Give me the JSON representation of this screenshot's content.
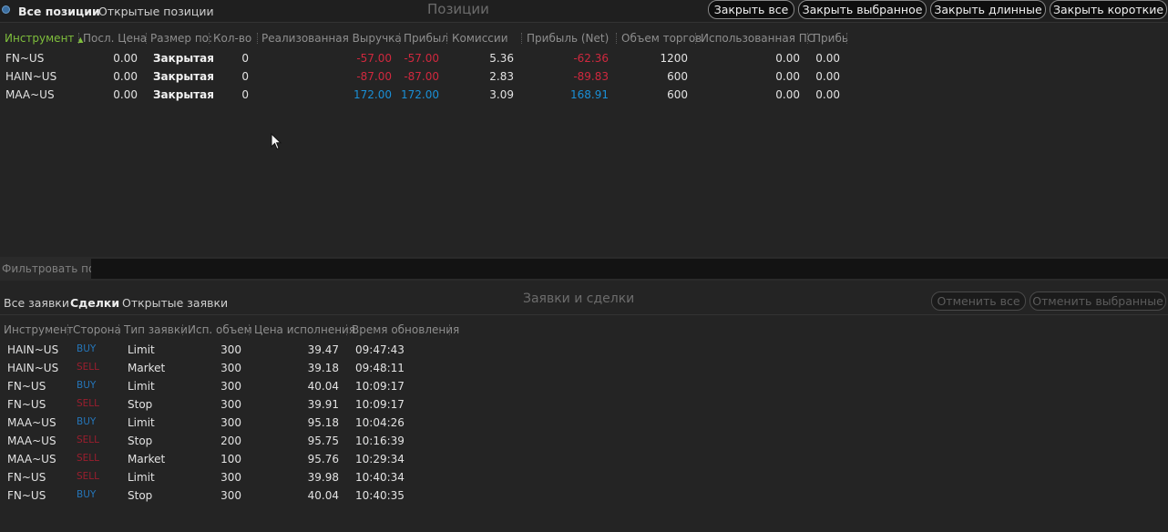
{
  "positions": {
    "tabs": [
      "Все позиции",
      "Открытые позиции"
    ],
    "title": "Позиции",
    "buttons": [
      "Закрыть все",
      "Закрыть выбранное",
      "Закрыть длинные",
      "Закрыть короткие"
    ],
    "columns": [
      "Инструмент",
      "Посл. Цена",
      "Размер по:",
      "Кол-во",
      "Реализованная Выручка",
      "Прибыл",
      "Комиссии",
      "Прибыль (Net)",
      "Объем торгов",
      "Использованная ПС",
      "Прибь"
    ],
    "rows": [
      {
        "instrument": "FN~US",
        "last": "0.00",
        "size": "Закрытая",
        "qty": "0",
        "revenue": "-57.00",
        "profit": "-57.00",
        "commission": "5.36",
        "net": "-62.36",
        "volume": "1200",
        "used": "0.00",
        "extra": "0.00"
      },
      {
        "instrument": "HAIN~US",
        "last": "0.00",
        "size": "Закрытая",
        "qty": "0",
        "revenue": "-87.00",
        "profit": "-87.00",
        "commission": "2.83",
        "net": "-89.83",
        "volume": "600",
        "used": "0.00",
        "extra": "0.00"
      },
      {
        "instrument": "MAA~US",
        "last": "0.00",
        "size": "Закрытая",
        "qty": "0",
        "revenue": "172.00",
        "profit": "172.00",
        "commission": "3.09",
        "net": "168.91",
        "volume": "600",
        "used": "0.00",
        "extra": "0.00"
      }
    ]
  },
  "filter": {
    "label": "Фильтровать по",
    "value": ""
  },
  "orders": {
    "tabs": [
      "Все заявки",
      "Сделки",
      "Открытые заявки"
    ],
    "title": "Заявки и сделки",
    "buttons": [
      "Отменить все",
      "Отменить выбранные"
    ],
    "columns": [
      "Инструмент",
      "Сторона",
      "Тип заявки",
      "Исп. объем",
      "Цена исполнения",
      "Время обновления"
    ],
    "rows": [
      {
        "instrument": "HAIN~US",
        "side": "BUY",
        "type": "Limit",
        "volume": "300",
        "price": "39.47",
        "time": "09:47:43"
      },
      {
        "instrument": "HAIN~US",
        "side": "SELL",
        "type": "Market",
        "volume": "300",
        "price": "39.18",
        "time": "09:48:11"
      },
      {
        "instrument": "FN~US",
        "side": "BUY",
        "type": "Limit",
        "volume": "300",
        "price": "40.04",
        "time": "10:09:17"
      },
      {
        "instrument": "FN~US",
        "side": "SELL",
        "type": "Stop",
        "volume": "300",
        "price": "39.91",
        "time": "10:09:17"
      },
      {
        "instrument": "MAA~US",
        "side": "BUY",
        "type": "Limit",
        "volume": "300",
        "price": "95.18",
        "time": "10:04:26"
      },
      {
        "instrument": "MAA~US",
        "side": "SELL",
        "type": "Stop",
        "volume": "200",
        "price": "95.75",
        "time": "10:16:39"
      },
      {
        "instrument": "MAA~US",
        "side": "SELL",
        "type": "Market",
        "volume": "100",
        "price": "95.76",
        "time": "10:29:34"
      },
      {
        "instrument": "FN~US",
        "side": "SELL",
        "type": "Limit",
        "volume": "300",
        "price": "39.98",
        "time": "10:40:34"
      },
      {
        "instrument": "FN~US",
        "side": "BUY",
        "type": "Stop",
        "volume": "300",
        "price": "40.04",
        "time": "10:40:35"
      }
    ]
  },
  "colors": {
    "sorted_header": "#7fbf3c",
    "negative": "#d0283e",
    "positive": "#1a8fd6",
    "buy": "#2575b8",
    "sell": "#9a1e2e"
  },
  "icons": {
    "sort": "sort-ascending-icon",
    "cursor": "mouse-cursor-icon"
  }
}
